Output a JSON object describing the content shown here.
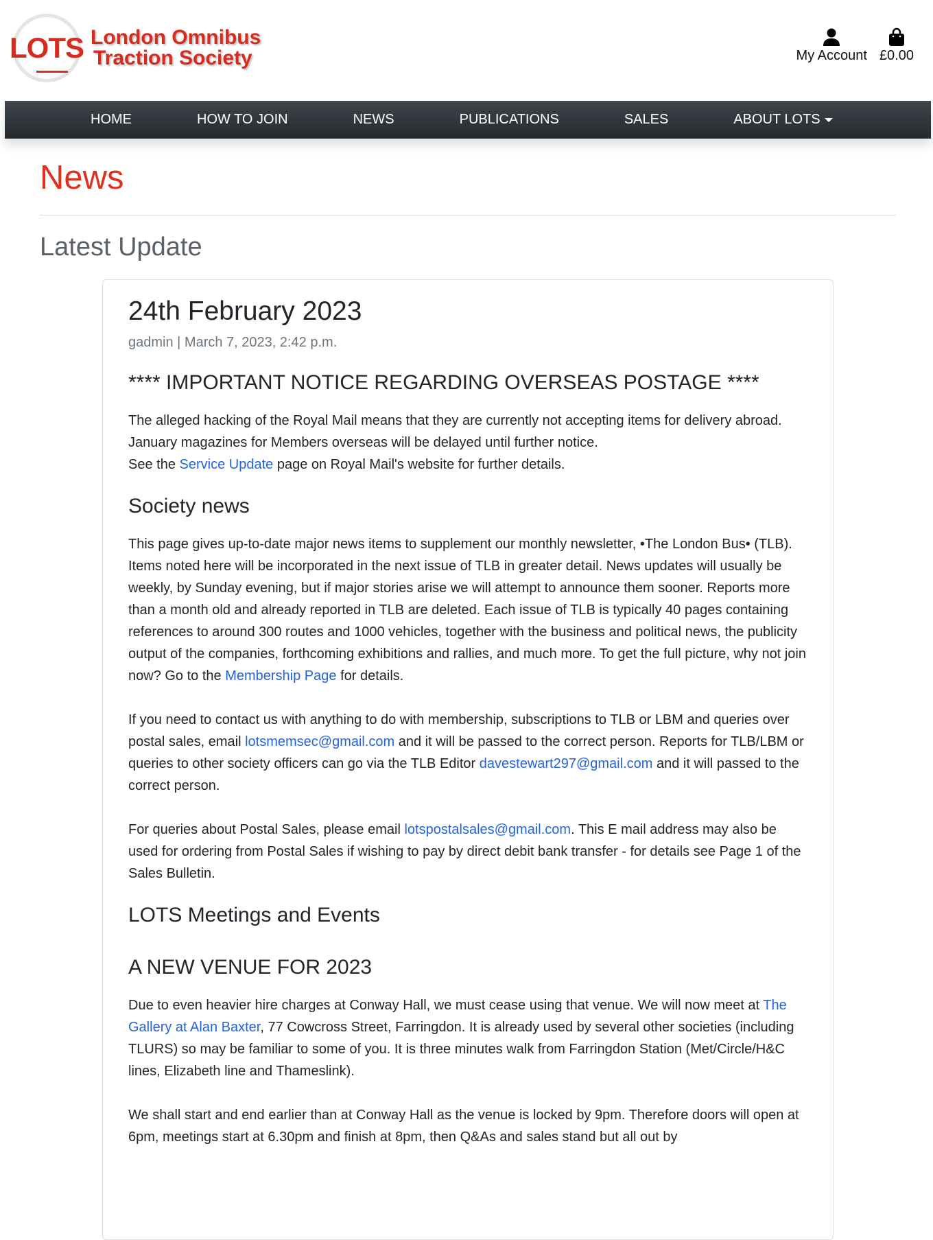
{
  "header": {
    "logo_badge": "LOTS",
    "logo_line1": "London Omnibus",
    "logo_line2": "Traction Society",
    "account_label": "My Account",
    "cart_total": "£0.00"
  },
  "nav": {
    "items": [
      {
        "label": "HOME"
      },
      {
        "label": "HOW TO JOIN"
      },
      {
        "label": "NEWS"
      },
      {
        "label": "PUBLICATIONS"
      },
      {
        "label": "SALES"
      },
      {
        "label": "ABOUT LOTS"
      }
    ]
  },
  "page": {
    "title": "News",
    "section_title": "Latest Update"
  },
  "post": {
    "title": "24th February 2023",
    "meta": "gadmin | March 7, 2023, 2:42 p.m.",
    "notice_heading": "**** IMPORTANT NOTICE REGARDING OVERSEAS POSTAGE ****",
    "notice_p1": "The alleged hacking of the Royal Mail means that they are currently not accepting items for delivery abroad. January magazines for Members overseas will be delayed until further notice.",
    "notice_p2_pre": "See the ",
    "notice_p2_link": "Service Update",
    "notice_p2_post": " page on Royal Mail's website for further details.",
    "society_heading": "Society news",
    "society_p1_pre": "This page gives up-to-date major news items to supplement our monthly newsletter, •The London Bus• (TLB). Items noted here will be incorporated in the next issue of TLB in greater detail. News updates will usually be weekly, by Sunday evening, but if major stories arise we will attempt to announce them sooner. Reports more than a month old and already reported in TLB are deleted. Each issue of TLB is typically 40 pages containing references to around 300 routes and 1000 vehicles, together with the business and political news, the publicity output of the companies, forthcoming exhibitions and rallies, and much more. To get the full picture, why not join now? Go to the ",
    "society_p1_link": "Membership Page",
    "society_p1_post": " for details.",
    "contact_p_pre": "If you need to contact us with anything to do with membership, subscriptions to TLB or LBM and queries over postal sales, email ",
    "contact_email1": "lotsmemsec@gmail.com",
    "contact_p_mid": " and it will be passed to the correct person. Reports for TLB/LBM or queries to other society officers can go via the TLB Editor ",
    "contact_email2": "davestewart297@gmail.com",
    "contact_p_post": " and it will passed to the correct person.",
    "postal_p_pre": "For queries about Postal Sales, please email ",
    "postal_email": "lotspostalsales@gmail.com",
    "postal_p_post": ". This E mail address may also be used for ordering from Postal Sales if wishing to pay by direct debit bank transfer - for details see Page 1 of the Sales Bulletin.",
    "meetings_heading": "LOTS Meetings and Events",
    "venue_heading": "A NEW VENUE FOR 2023",
    "venue_p_pre": "Due to even heavier hire charges at Conway Hall, we must cease using that venue. We will now meet at ",
    "venue_link": "The Gallery at Alan Baxter",
    "venue_p_post": ", 77 Cowcross Street, Farringdon. It is already used by several other societies (including TLURS) so may be familiar to some of you. It is three minutes walk from Farringdon Station (Met/Circle/H&C lines, Elizabeth line and Thameslink).",
    "times_p": "We shall start and end earlier than at Conway Hall as the venue is locked by 9pm. Therefore doors will open at 6pm, meetings start at 6.30pm and finish at 8pm, then Q&As and sales stand but all out by"
  }
}
